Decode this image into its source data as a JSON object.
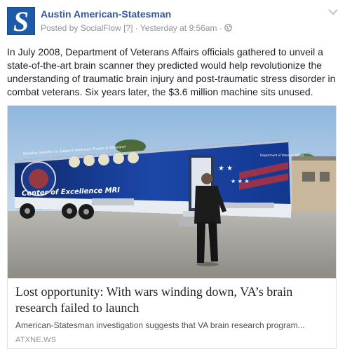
{
  "post": {
    "page_name": "Austin American-Statesman",
    "avatar_letter": "S",
    "posted_by_prefix": "Posted by ",
    "poster": "SocialFlow",
    "help_marker": " [?]",
    "separator": " · ",
    "timestamp": "Yesterday at 9:56am",
    "separator2": " · ",
    "audience_icon": "globe-icon",
    "menu_icon": "chevron-down-icon",
    "text": "In July 2008, Department of Veterans Affairs officials gathered to unveil a state-of-the-art brain scanner they predicted would help revolutionize the understanding of traumatic brain injury and post-traumatic stress disorder in combat veterans. Six years later, the $3.6 million machine sits unused."
  },
  "link_card": {
    "image": {
      "banner_text": "Working together to Support America's Troops & Veterans!",
      "trailer_label": "Center of Excellence MRI",
      "department_text": "Department of Veterans Affairs"
    },
    "title": "Lost opportunity: With wars winding down, VA’s brain research failed to launch",
    "description": "American-Statesman investigation suggests that VA brain research program...",
    "domain": "ATXNE.WS"
  },
  "colors": {
    "link_blue": "#365899",
    "meta_gray": "#90949c",
    "brand_blue": "#1d5aa7"
  }
}
